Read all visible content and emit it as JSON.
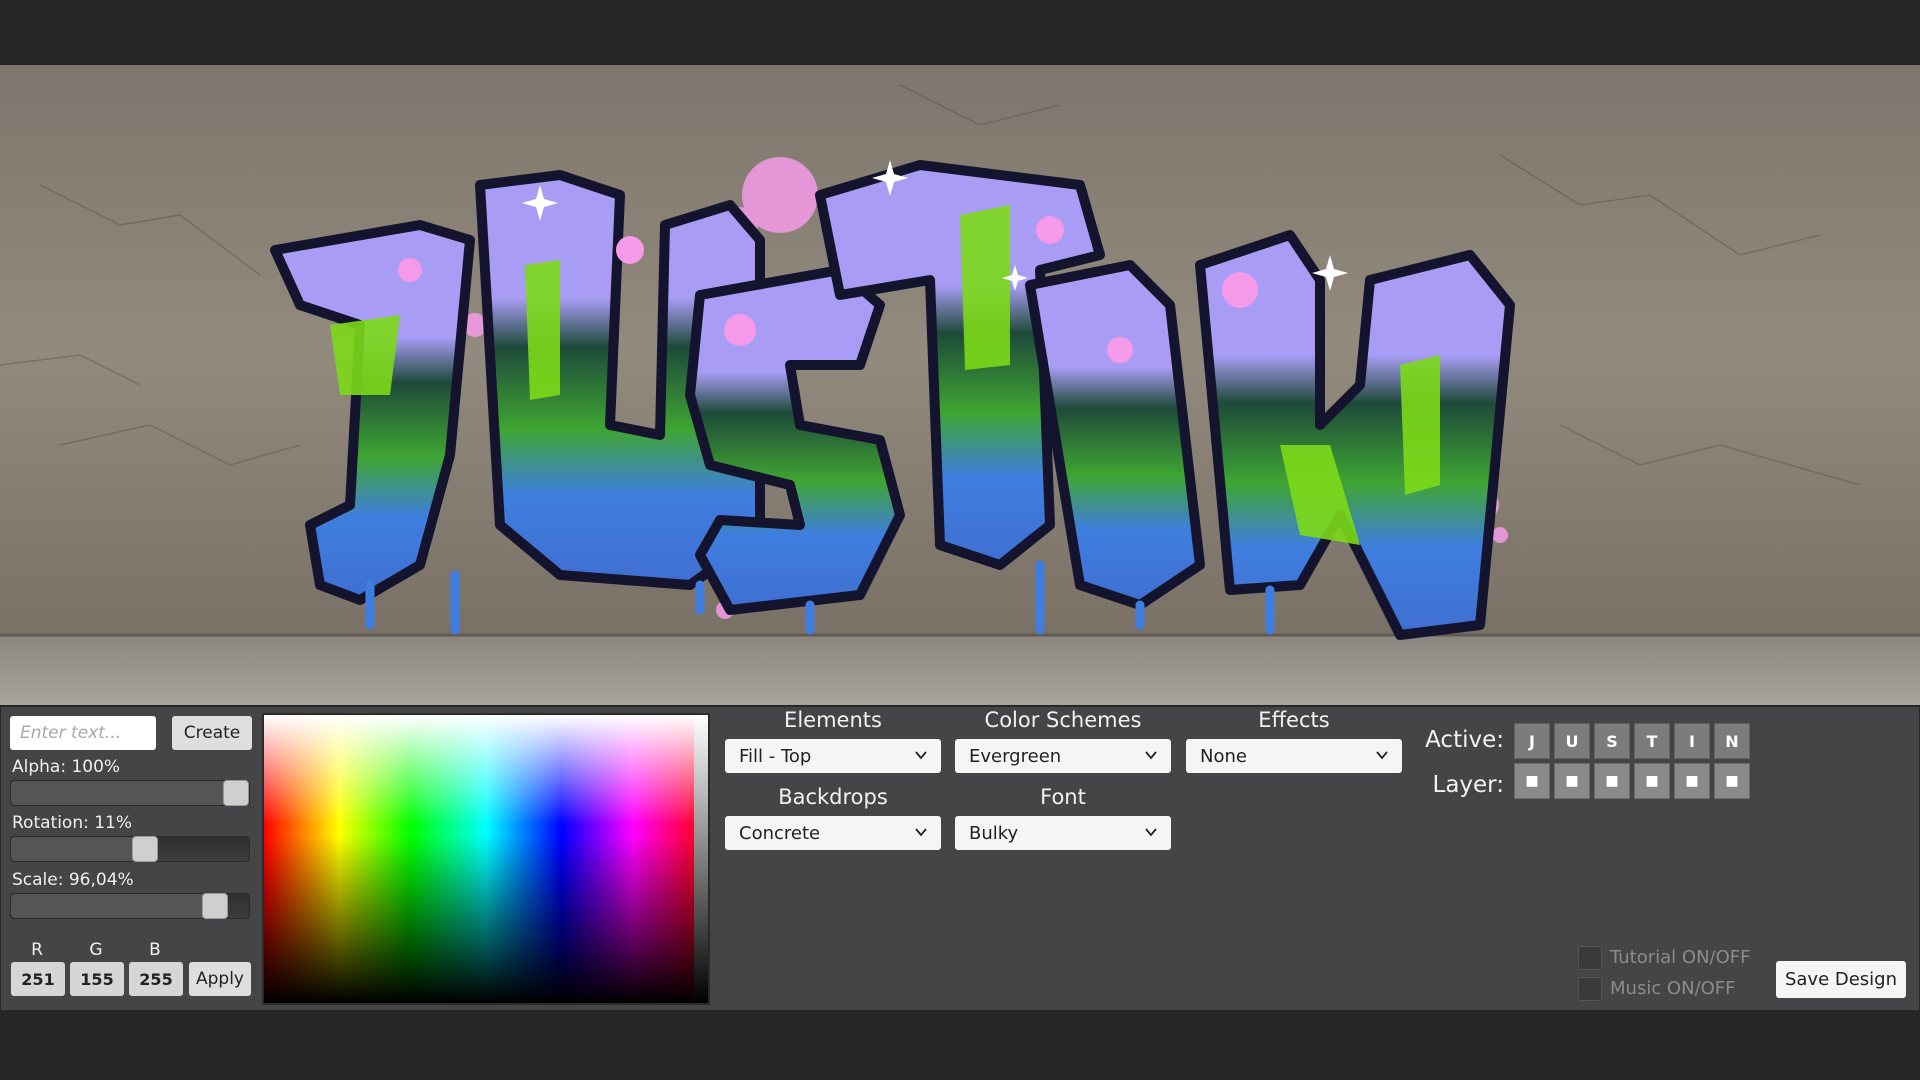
{
  "toolbar": {
    "text_input_value": "",
    "text_input_placeholder": "Enter text...",
    "create_label": "Create"
  },
  "sliders": {
    "alpha": {
      "label": "Alpha: 100%",
      "value": 1.0
    },
    "rotation": {
      "label": "Rotation: 11%",
      "value": 0.57
    },
    "scale": {
      "label": "Scale: 96,04%",
      "value": 0.9
    }
  },
  "rgb": {
    "r_label": "R",
    "g_label": "G",
    "b_label": "B",
    "r": "251",
    "g": "155",
    "b": "255",
    "apply_label": "Apply"
  },
  "dropdowns": {
    "elements": {
      "title": "Elements",
      "value": "Fill - Top"
    },
    "color_schemes": {
      "title": "Color Schemes",
      "value": "Evergreen"
    },
    "effects": {
      "title": "Effects",
      "value": "None"
    },
    "backdrops": {
      "title": "Backdrops",
      "value": "Concrete"
    },
    "font": {
      "title": "Font",
      "value": "Bulky"
    }
  },
  "active": {
    "label": "Active:",
    "letters": [
      "J",
      "U",
      "S",
      "T",
      "I",
      "N"
    ]
  },
  "layer": {
    "label": "Layer:",
    "buttons": [
      "■",
      "■",
      "■",
      "■",
      "■",
      "■"
    ]
  },
  "toggles": {
    "tutorial_label": "Tutorial ON/OFF",
    "music_label": "Music ON/OFF"
  },
  "save_label": "Save Design",
  "canvas": {
    "graffiti_text": "JUSTIN",
    "colors": {
      "fill_top": "#a99cf5",
      "fill_mid": "#7cd918",
      "fill_bottom": "#3f7ee0",
      "outline": "#15142e",
      "splatter": "#f59ae8",
      "wall": "#8d8478",
      "floor": "#9a958d"
    }
  }
}
